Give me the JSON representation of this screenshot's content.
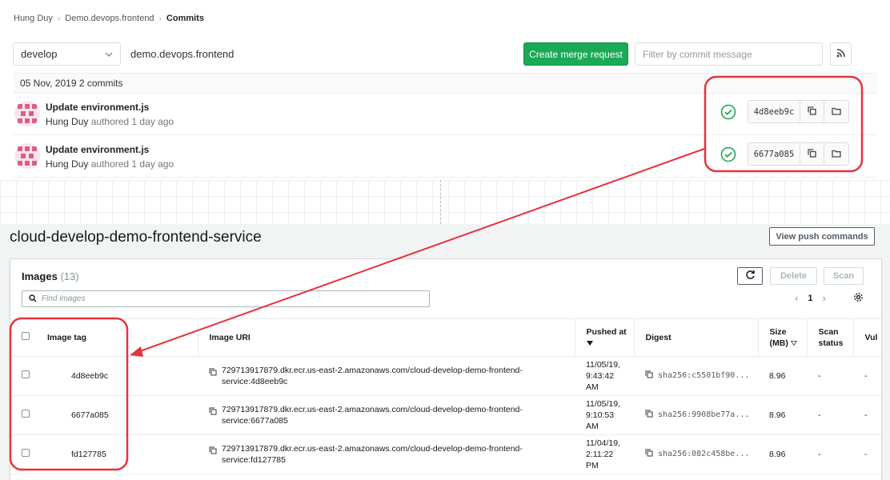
{
  "gitlab": {
    "breadcrumb": [
      "Hung Duy",
      "Demo.devops.frontend",
      "Commits"
    ],
    "branch": "develop",
    "repo_name": "demo.devops.frontend",
    "create_mr_label": "Create merge request",
    "filter_placeholder": "Filter by commit message",
    "day_header": "05 Nov, 2019 2 commits",
    "commits": [
      {
        "title": "Update environment.js",
        "author": "Hung Duy",
        "authored": "authored 1 day ago",
        "sha": "4d8eeb9c",
        "status": "success"
      },
      {
        "title": "Update environment.js",
        "author": "Hung Duy",
        "authored": "authored 1 day ago",
        "sha": "6677a085",
        "status": "success"
      }
    ]
  },
  "ecr": {
    "repo_title": "cloud-develop-demo-frontend-service",
    "view_push_label": "View push commands",
    "images_title": "Images",
    "images_count": "(13)",
    "delete_label": "Delete",
    "scan_label": "Scan",
    "search_placeholder": "Find images",
    "page": "1",
    "columns": {
      "tag": "Image tag",
      "uri": "Image URI",
      "pushed": "Pushed at",
      "digest": "Digest",
      "size": "Size (MB)",
      "scan": "Scan status",
      "vul": "Vul"
    },
    "rows": [
      {
        "tag": "4d8eeb9c",
        "uri": "729713917879.dkr.ecr.us-east-2.amazonaws.com/cloud-develop-demo-frontend-service:4d8eeb9c",
        "uri_line1": "729713917879.dkr.ecr.us-east-2.amazonaws.com/cloud-develop-demo-frontend-",
        "uri_line2": "service:4d8eeb9c",
        "pushed": "11/05/19, 9:43:42 AM",
        "digest": "sha256:c5501bf90...",
        "size": "8.96",
        "scan": "-",
        "vul": "-"
      },
      {
        "tag": "6677a085",
        "uri": "729713917879.dkr.ecr.us-east-2.amazonaws.com/cloud-develop-demo-frontend-service:6677a085",
        "uri_line1": "729713917879.dkr.ecr.us-east-2.amazonaws.com/cloud-develop-demo-frontend-",
        "uri_line2": "service:6677a085",
        "pushed": "11/05/19, 9:10:53 AM",
        "digest": "sha256:9908be77a...",
        "size": "8.96",
        "scan": "-",
        "vul": "-"
      },
      {
        "tag": "fd127785",
        "uri": "729713917879.dkr.ecr.us-east-2.amazonaws.com/cloud-develop-demo-frontend-service:fd127785",
        "uri_line1": "729713917879.dkr.ecr.us-east-2.amazonaws.com/cloud-develop-demo-frontend-",
        "uri_line2": "service:fd127785",
        "pushed": "11/04/19, 2:11:22 PM",
        "digest": "sha256:082c458be...",
        "size": "8.96",
        "scan": "-",
        "vul": "-"
      }
    ]
  },
  "colors": {
    "accent_green": "#1aaa55",
    "annotation_red": "#e8323c",
    "aws_gray": "#545b64"
  }
}
